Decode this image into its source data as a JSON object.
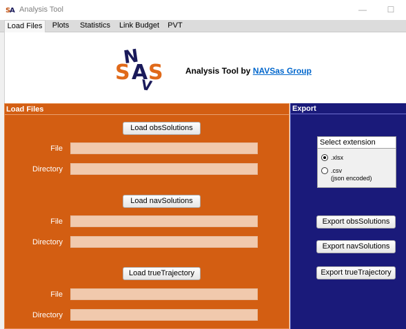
{
  "window": {
    "title": "Analysis Tool",
    "minimize_glyph": "—",
    "maximize_glyph": "☐"
  },
  "tabs": [
    {
      "label": "Load Files",
      "active": true
    },
    {
      "label": "Plots",
      "active": false
    },
    {
      "label": "Statistics",
      "active": false
    },
    {
      "label": "Link Budget",
      "active": false
    },
    {
      "label": "PVT",
      "active": false
    }
  ],
  "header": {
    "logo_text": "NAVSAS",
    "title_prefix": "Analysis Tool by ",
    "link_text": "NAVSas Group"
  },
  "load_panel": {
    "title": "Load Files",
    "sections": [
      {
        "button": "Load obsSolutions",
        "file_label": "File",
        "file_value": "",
        "dir_label": "Directory",
        "dir_value": ""
      },
      {
        "button": "Load navSolutions",
        "file_label": "File",
        "file_value": "",
        "dir_label": "Directory",
        "dir_value": ""
      },
      {
        "button": "Load trueTrajectory",
        "file_label": "File",
        "file_value": "",
        "dir_label": "Directory",
        "dir_value": ""
      }
    ]
  },
  "export_panel": {
    "title": "Export",
    "select_title": "Select extension",
    "options": [
      {
        "label": ".xlsx",
        "sublabel": "",
        "checked": true
      },
      {
        "label": ".csv",
        "sublabel": "(json encoded)",
        "checked": false
      }
    ],
    "buttons": [
      "Export obsSolutions",
      "Export navSolutions",
      "Export trueTrajectory"
    ]
  },
  "colors": {
    "load_panel_bg": "#d35e12",
    "export_panel_bg": "#1a1a7a",
    "input_bg": "#f1c9ad",
    "link": "#0066cc",
    "logo_orange": "#e06a1a",
    "logo_navy": "#1a1a5a"
  },
  "icons": [
    "app-icon",
    "navsas-logo"
  ]
}
